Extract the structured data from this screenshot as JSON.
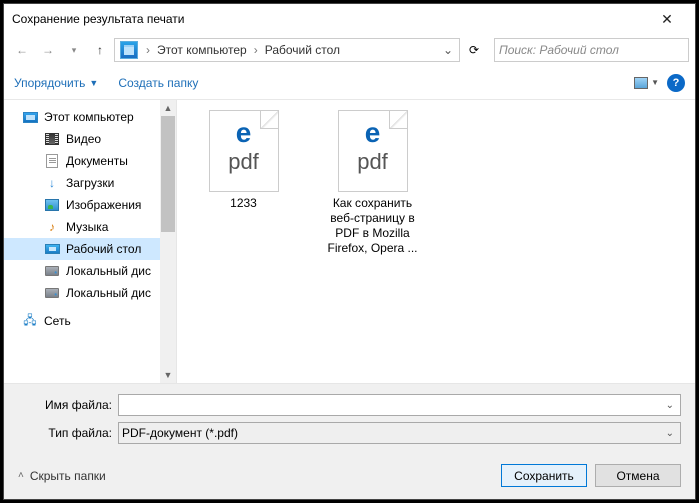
{
  "title": "Сохранение результата печати",
  "breadcrumb": {
    "item1": "Этот компьютер",
    "item2": "Рабочий стол"
  },
  "search": {
    "placeholder": "Поиск: Рабочий стол"
  },
  "toolbar": {
    "organize": "Упорядочить",
    "new_folder": "Создать папку"
  },
  "tree": {
    "root": "Этот компьютер",
    "videos": "Видео",
    "documents": "Документы",
    "downloads": "Загрузки",
    "images": "Изображения",
    "music": "Музыка",
    "desktop": "Рабочий стол",
    "localdisk1": "Локальный дис",
    "localdisk2": "Локальный дис",
    "network": "Сеть"
  },
  "files": {
    "f1": {
      "name": "1233"
    },
    "f2": {
      "name": "Как сохранить веб-страницу в PDF в Mozilla Firefox, Opera ..."
    }
  },
  "form": {
    "filename_label": "Имя файла:",
    "filetype_label": "Тип файла:",
    "filetype_value": "PDF-документ (*.pdf)"
  },
  "footer": {
    "hide_folders": "Скрыть папки",
    "save": "Сохранить",
    "cancel": "Отмена"
  }
}
